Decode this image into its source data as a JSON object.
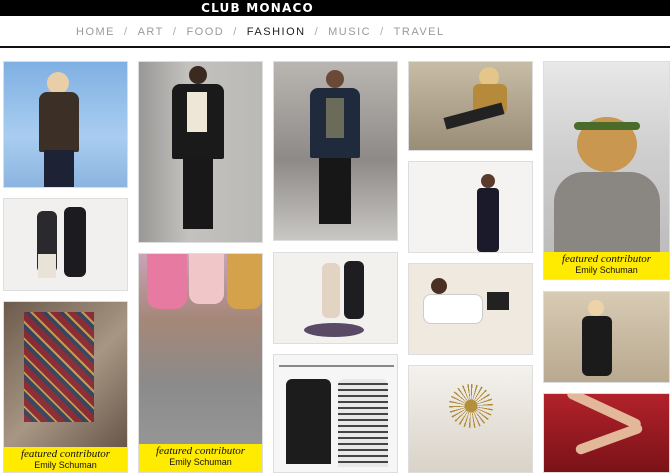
{
  "brand": {
    "logo_text": "CLUB MONACO"
  },
  "nav": {
    "items": [
      "HOME",
      "ART",
      "FOOD",
      "FASHION",
      "MUSIC",
      "TRAVEL"
    ],
    "separator": "/",
    "active": "FASHION"
  },
  "contributor": {
    "label": "featured contributor",
    "name": "Emily Schuman"
  },
  "colors": {
    "caption_bg": "#ffeb00",
    "topbar": "#000000"
  }
}
